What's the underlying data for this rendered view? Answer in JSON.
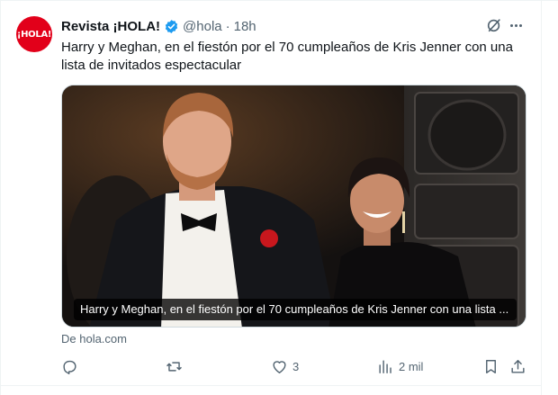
{
  "author": {
    "avatar_text": "¡HOLA!",
    "name": "Revista ¡HOLA!",
    "handle": "@hola",
    "separator": "·",
    "time": "18h"
  },
  "tweet": {
    "text": "Harry y Meghan, en el fiestón por el 70 cumpleaños de Kris Jenner con una lista de invitados espectacular"
  },
  "media": {
    "caption": "Harry y Meghan, en el fiestón por el 70 cumpleaños de Kris Jenner con una lista ..."
  },
  "source": "De hola.com",
  "actions": {
    "reply_count": "",
    "retweet_count": "",
    "like_count": "3",
    "views_count": "2 mil"
  },
  "icons": [
    "grok-icon",
    "more-icon",
    "verified-icon",
    "reply-icon",
    "retweet-icon",
    "like-icon",
    "views-icon",
    "bookmark-icon",
    "share-icon"
  ],
  "colors": {
    "text": "#0f1419",
    "secondary": "#536471",
    "verified": "#1d9bf0",
    "brand": "#e2001a"
  }
}
